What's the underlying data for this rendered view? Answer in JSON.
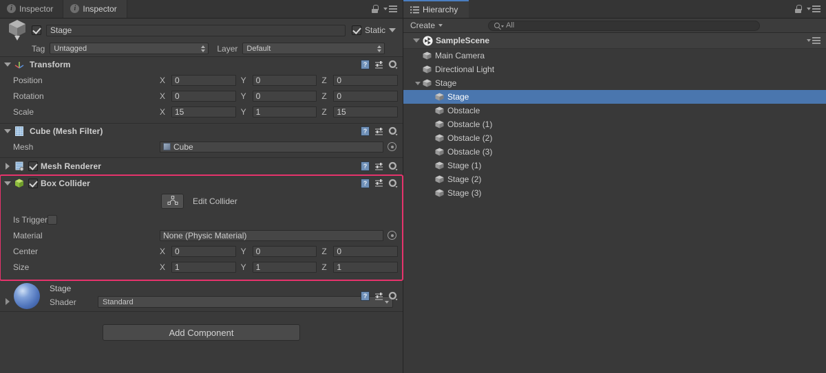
{
  "inspector": {
    "tabs": [
      {
        "label": "Inspector",
        "icon": "info-icon",
        "active": false
      },
      {
        "label": "Inspector",
        "icon": "info-icon",
        "active": true
      }
    ],
    "lock_icon": "lock-icon",
    "menu_icon": "hamburger-menu-icon",
    "gameobject": {
      "icon": "cube-gameobject-icon",
      "enabled_checkbox": "checked",
      "name": "Stage",
      "static_label": "Static",
      "static_checked": "checked",
      "tag_label": "Tag",
      "tag_value": "Untagged",
      "layer_label": "Layer",
      "layer_value": "Default"
    },
    "components": [
      {
        "title": "Transform",
        "icon": "transform-axis-icon",
        "expanded": true,
        "rows": [
          {
            "label": "Position",
            "x": "0",
            "y": "0",
            "z": "0"
          },
          {
            "label": "Rotation",
            "x": "0",
            "y": "0",
            "z": "0"
          },
          {
            "label": "Scale",
            "x": "15",
            "y": "1",
            "z": "15"
          }
        ],
        "axis_x": "X",
        "axis_y": "Y",
        "axis_z": "Z"
      },
      {
        "title": "Cube (Mesh Filter)",
        "icon": "mesh-filter-icon",
        "expanded": true,
        "mesh_label": "Mesh",
        "mesh_value": "Cube"
      },
      {
        "title": "Mesh Renderer",
        "icon": "mesh-renderer-icon",
        "expanded": false,
        "enabled_checkbox": "checked"
      },
      {
        "title": "Box Collider",
        "icon": "box-collider-icon",
        "expanded": true,
        "enabled_checkbox": "checked",
        "highlighted": true,
        "highlight_color": "#e8336c",
        "edit_collider_label": "Edit Collider",
        "edit_collider_icon": "edit-polygon-icon",
        "is_trigger_label": "Is Trigger",
        "is_trigger_checked": false,
        "material_label": "Material",
        "material_value": "None (Physic Material)",
        "center_label": "Center",
        "center": {
          "x": "0",
          "y": "0",
          "z": "0"
        },
        "size_label": "Size",
        "size": {
          "x": "1",
          "y": "1",
          "z": "1"
        }
      }
    ],
    "material": {
      "preview_icon": "material-sphere-preview",
      "name": "Stage",
      "shader_label": "Shader",
      "shader_value": "Standard"
    },
    "add_component_label": "Add Component",
    "tool_icons": {
      "help": "?",
      "help_name": "help-icon",
      "preset": "preset-icon",
      "gear": "gear-icon"
    }
  },
  "hierarchy": {
    "tab_label": "Hierarchy",
    "tab_icon": "hierarchy-list-icon",
    "lock_icon": "lock-icon",
    "menu_icon": "hamburger-menu-icon",
    "create_label": "Create",
    "search_placeholder": "All",
    "search_icon": "search-icon",
    "scene": {
      "name": "SampleScene",
      "icon": "unity-logo-icon",
      "expanded": true
    },
    "items": [
      {
        "label": "Main Camera",
        "depth": 1,
        "expandable": false,
        "selected": false
      },
      {
        "label": "Directional Light",
        "depth": 1,
        "expandable": false,
        "selected": false
      },
      {
        "label": "Stage",
        "depth": 1,
        "expandable": true,
        "selected": false
      },
      {
        "label": "Stage",
        "depth": 2,
        "expandable": false,
        "selected": true
      },
      {
        "label": "Obstacle",
        "depth": 2,
        "expandable": false,
        "selected": false
      },
      {
        "label": "Obstacle (1)",
        "depth": 2,
        "expandable": false,
        "selected": false
      },
      {
        "label": "Obstacle (2)",
        "depth": 2,
        "expandable": false,
        "selected": false
      },
      {
        "label": "Obstacle (3)",
        "depth": 2,
        "expandable": false,
        "selected": false
      },
      {
        "label": "Stage (1)",
        "depth": 2,
        "expandable": false,
        "selected": false
      },
      {
        "label": "Stage (2)",
        "depth": 2,
        "expandable": false,
        "selected": false
      },
      {
        "label": "Stage (3)",
        "depth": 2,
        "expandable": false,
        "selected": false
      }
    ],
    "selection_color": "#4a76ae"
  }
}
